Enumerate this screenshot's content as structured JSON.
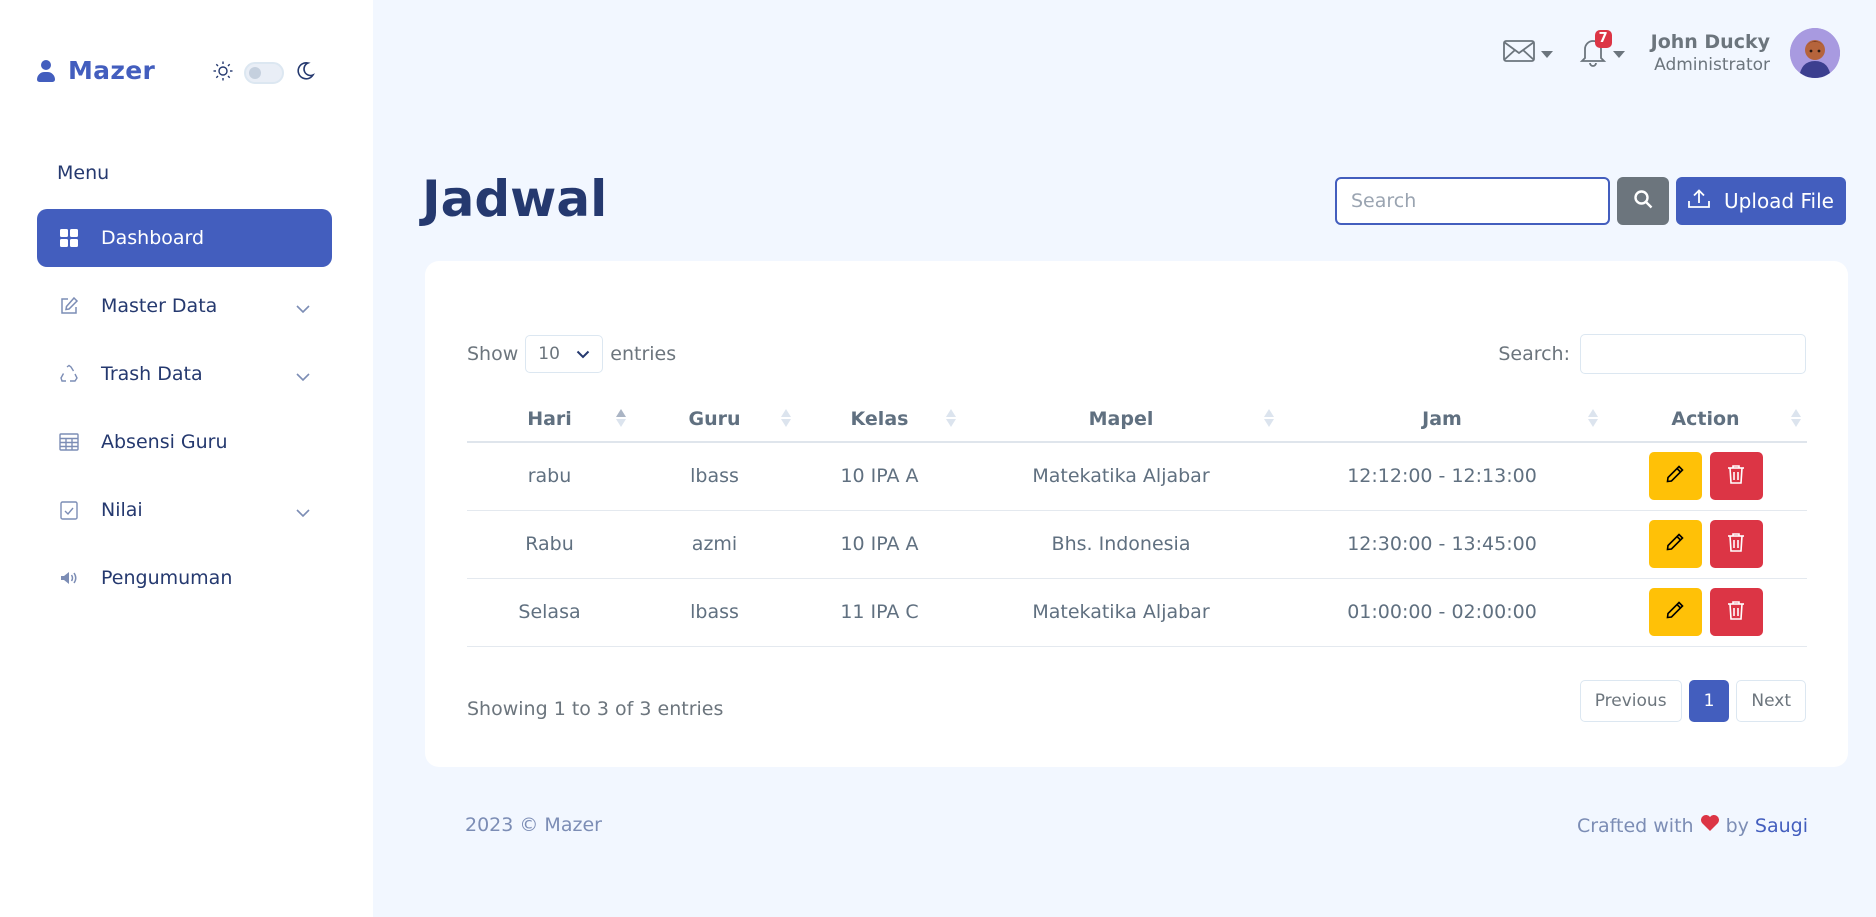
{
  "brand": {
    "name": "Mazer",
    "color": "#435ebe"
  },
  "sidebar": {
    "menu_title": "Menu",
    "items": [
      {
        "label": "Dashboard",
        "icon": "grid-icon",
        "active": true
      },
      {
        "label": "Master Data",
        "icon": "pencil-square-icon",
        "has_submenu": true
      },
      {
        "label": "Trash Data",
        "icon": "recycle-icon",
        "has_submenu": true
      },
      {
        "label": "Absensi Guru",
        "icon": "table-icon"
      },
      {
        "label": "Nilai",
        "icon": "check-clipboard-icon",
        "has_submenu": true
      },
      {
        "label": "Pengumuman",
        "icon": "megaphone-icon"
      }
    ]
  },
  "header": {
    "notification_count": "7",
    "user": {
      "name": "John Ducky",
      "role": "Administrator"
    }
  },
  "page": {
    "title": "Jadwal",
    "search_placeholder": "Search",
    "upload_label": "Upload File"
  },
  "table": {
    "show_label": "Show",
    "entries_value": "10",
    "entries_label": "entries",
    "search_label": "Search:",
    "columns": [
      "Hari",
      "Guru",
      "Kelas",
      "Mapel",
      "Jam",
      "Action"
    ],
    "rows": [
      [
        "rabu",
        "lbass",
        "10 IPA A",
        "Matekatika Aljabar",
        "12:12:00 - 12:13:00"
      ],
      [
        "Rabu",
        "azmi",
        "10 IPA A",
        "Bhs. Indonesia",
        "12:30:00 - 13:45:00"
      ],
      [
        "Selasa",
        "lbass",
        "11 IPA C",
        "Matekatika Aljabar",
        "01:00:00 - 02:00:00"
      ]
    ],
    "info": "Showing 1 to 3 of 3 entries",
    "pagination": {
      "previous": "Previous",
      "current": "1",
      "next": "Next"
    }
  },
  "footer": {
    "left": "2023 © Mazer",
    "crafted": "Crafted with",
    "by": "by",
    "author": "Saugi"
  },
  "colors": {
    "primary": "#435ebe",
    "warning": "#ffc107",
    "danger": "#dc3545",
    "secondary": "#6c757d",
    "background": "#f2f7ff"
  }
}
